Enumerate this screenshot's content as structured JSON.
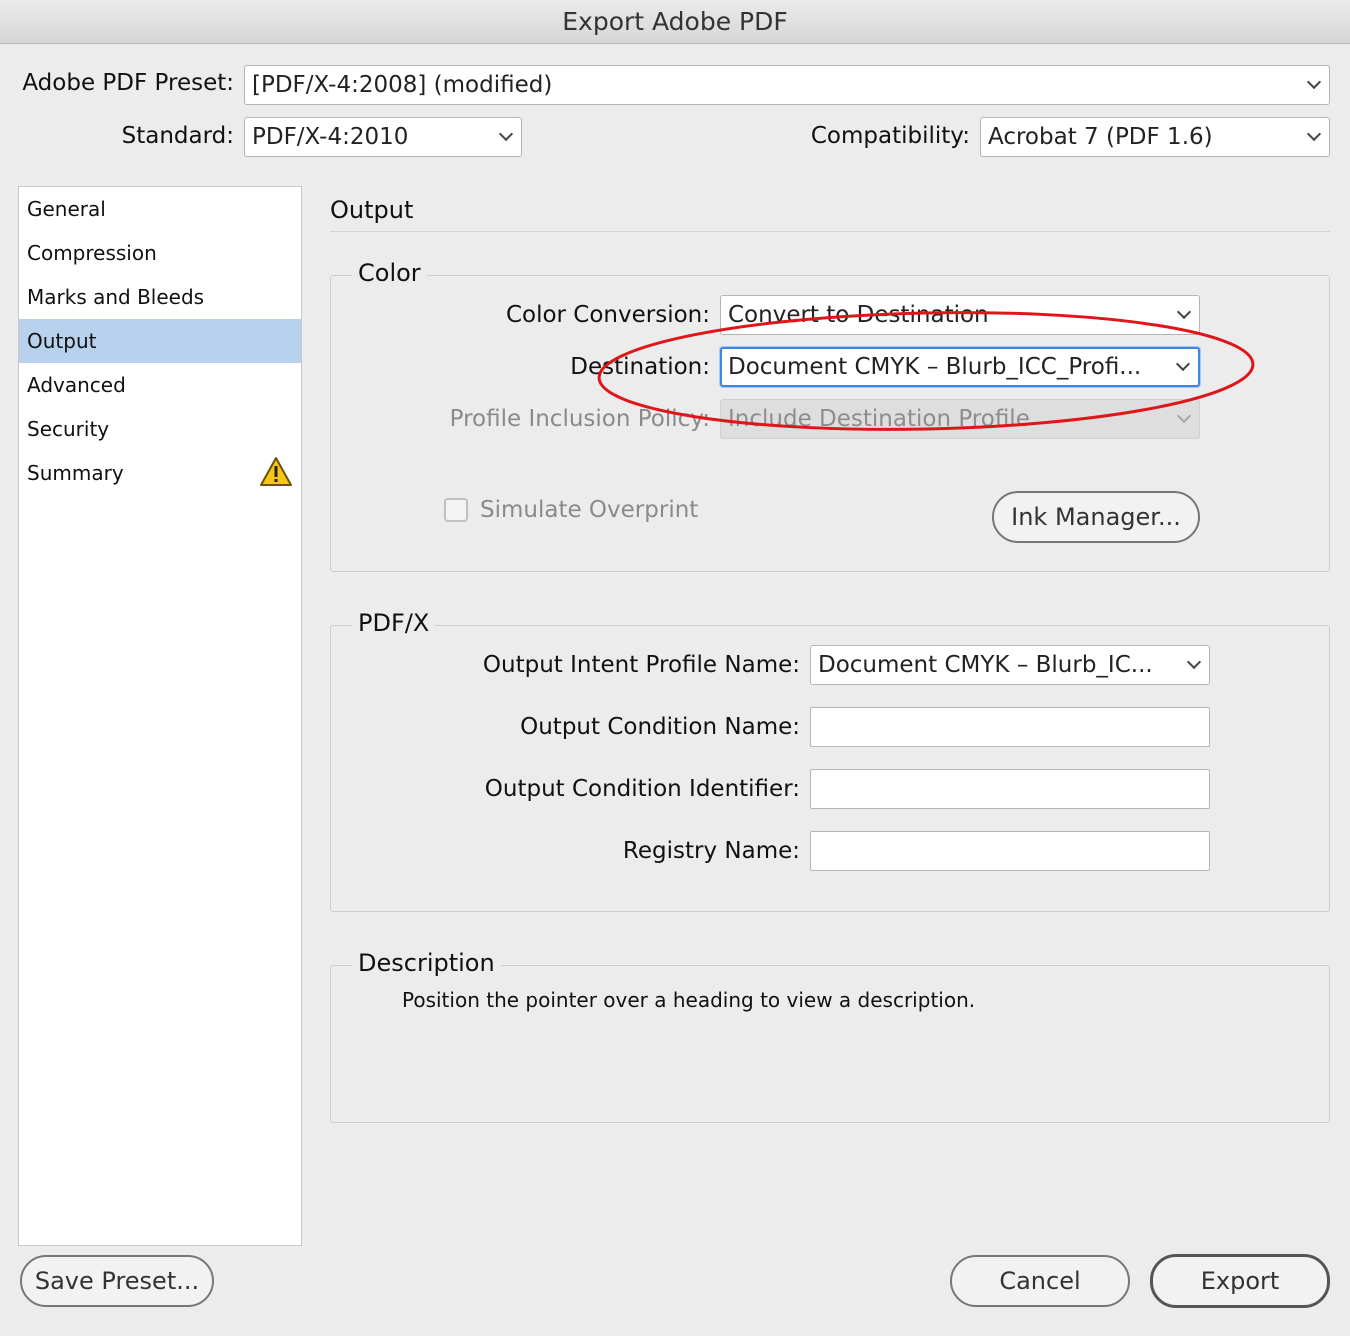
{
  "window": {
    "title": "Export Adobe PDF"
  },
  "top": {
    "preset_label": "Adobe PDF Preset:",
    "preset_value": "[PDF/X-4:2008] (modified)",
    "standard_label": "Standard:",
    "standard_value": "PDF/X-4:2010",
    "compat_label": "Compatibility:",
    "compat_value": "Acrobat 7 (PDF 1.6)"
  },
  "sidebar": {
    "items": [
      {
        "label": "General"
      },
      {
        "label": "Compression"
      },
      {
        "label": "Marks and Bleeds"
      },
      {
        "label": "Output",
        "selected": true
      },
      {
        "label": "Advanced"
      },
      {
        "label": "Security"
      },
      {
        "label": "Summary",
        "warning": true
      }
    ]
  },
  "main": {
    "heading": "Output",
    "color": {
      "title": "Color",
      "conversion_label": "Color Conversion:",
      "conversion_value": "Convert to Destination",
      "destination_label": "Destination:",
      "destination_value": "Document CMYK – Blurb_ICC_Profi...",
      "profile_label": "Profile Inclusion Policy:",
      "profile_value": "Include Destination Profile",
      "simulate_label": "Simulate Overprint",
      "ink_manager_label": "Ink Manager..."
    },
    "pdfx": {
      "title": "PDF/X",
      "intent_label": "Output Intent Profile Name:",
      "intent_value": "Document CMYK – Blurb_IC...",
      "condition_name_label": "Output Condition Name:",
      "condition_name_value": "",
      "condition_id_label": "Output Condition Identifier:",
      "condition_id_value": "",
      "registry_label": "Registry Name:",
      "registry_value": ""
    },
    "description": {
      "title": "Description",
      "text": "Position the pointer over a heading to view a description."
    }
  },
  "buttons": {
    "save_preset": "Save Preset...",
    "cancel": "Cancel",
    "export": "Export"
  },
  "colors": {
    "selection": "#b8d2ee",
    "focus_ring": "#3a86e0",
    "annotation": "#e0151a",
    "warning": "#f5c518"
  }
}
